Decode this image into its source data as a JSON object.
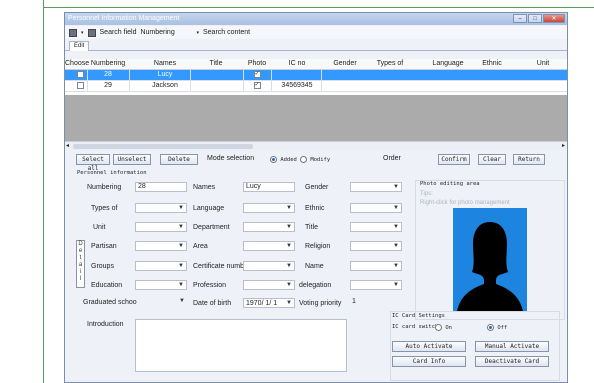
{
  "window": {
    "title": "Personnel Information Management"
  },
  "toolbar": {
    "search_field_label": "Search field",
    "search_field_value": "Numbering",
    "search_content_label": "Search content"
  },
  "tab": {
    "label": "Edit"
  },
  "grid": {
    "columns": [
      "Choose",
      "Numbering",
      "Names",
      "Title",
      "Photo",
      "IC no",
      "Gender",
      "Types of",
      "Language",
      "Ethnic",
      "Unit"
    ],
    "rows": [
      {
        "numbering": "28",
        "name": "Lucy",
        "ic_no": "",
        "photo": true
      },
      {
        "numbering": "29",
        "name": "Jackson",
        "ic_no": "34569345",
        "photo": true
      }
    ]
  },
  "actions": {
    "select_all": "Select all",
    "unselect": "Unselect",
    "delete": "Delete",
    "mode_label": "Mode selection",
    "mode_added": "Added",
    "mode_modify": "Modify",
    "order": "Order",
    "confirm": "Confirm",
    "clear": "Clear",
    "return": "Return"
  },
  "form": {
    "section_title": "Personnel information",
    "numbering_label": "Numbering",
    "numbering_value": "28",
    "names_label": "Names",
    "names_value": "Lucy",
    "gender_label": "Gender",
    "types_label": "Types of",
    "language_label": "Language",
    "ethnic_label": "Ethnic",
    "unit_label": "Unit",
    "department_label": "Department",
    "title_label": "Title",
    "partisan_label": "Partisan",
    "area_label": "Area",
    "religion_label": "Religion",
    "groups_label": "Groups",
    "certificate_label": "Certificate numb",
    "name_label": "Name",
    "education_label": "Education",
    "profession_label": "Profession",
    "delegation_label": "delegation",
    "graduated_label": "Graduated schoo",
    "dob_label": "Date of birth",
    "dob_value": "1970/ 1/ 1",
    "voting_label": "Voting priority",
    "voting_value": "1",
    "introduction_label": "Introduction",
    "side_tab": "Detail"
  },
  "photo": {
    "title": "Photo editing area",
    "tips": "Tips:",
    "hint": "Right-click for photo management"
  },
  "ic_card": {
    "title": "IC Card Settings",
    "switch_label": "IC card switch",
    "on": "On",
    "off": "Off",
    "auto_activate": "Auto Activate",
    "manual_activate": "Manual Activate",
    "card_info": "Card Info",
    "deactivate_card": "Deactivate Card"
  },
  "colors": {
    "selection": "#3399ff",
    "photo_bg": "#1d84e0"
  }
}
